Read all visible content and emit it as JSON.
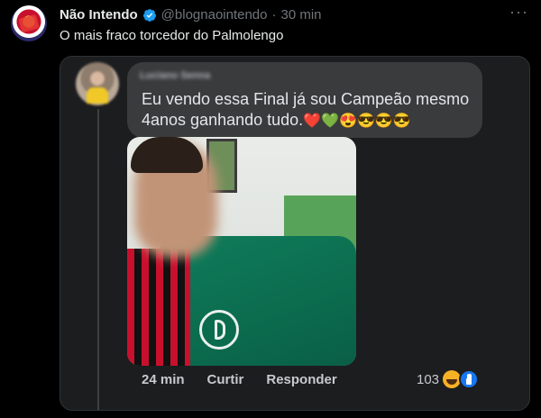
{
  "tweet": {
    "display_name": "Não Intendo",
    "handle": "@blognaointendo",
    "separator": "·",
    "time": "30 min",
    "text": "O mais fraco torcedor do Palmolengo",
    "verified_color": "#1d9bf0"
  },
  "embedded_comment": {
    "commenter_name": "Luciano Senna",
    "text_line1": "Eu vendo essa Final já sou Campeão mesmo",
    "text_line2": "4anos ganhando tudo.",
    "emojis": "❤️💚😍😎😎😎",
    "actions": {
      "time": "24 min",
      "like_label": "Curtir",
      "reply_label": "Responder"
    },
    "reactions": {
      "count": "103",
      "icons": [
        "haha-icon",
        "like-icon"
      ]
    }
  },
  "colors": {
    "background": "#000000",
    "card_background": "#1c1d1f",
    "bubble_background": "#3a3b3c",
    "facebook_blue": "#1877f2"
  }
}
